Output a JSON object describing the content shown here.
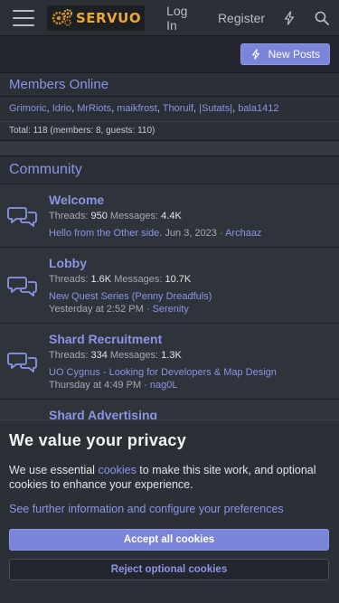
{
  "header": {
    "logo_text": "SERVUO",
    "login": "Log In",
    "register": "Register"
  },
  "new_posts_label": "New Posts",
  "members_online": {
    "title": "Members Online",
    "names": [
      "Grimoric",
      "Idrio",
      "MrRiots",
      "maikfrost",
      "Thorulf",
      "|Sutats|",
      "bala1412"
    ],
    "total": "Total: 118 (members: 8, guests: 110)"
  },
  "community": {
    "title": "Community",
    "forums": [
      {
        "title": "Welcome",
        "threads_label": "Threads:",
        "threads": "950",
        "messages_label": "Messages:",
        "messages": "4.4K",
        "latest": "Hello from the Other side.",
        "date": "Jun 3, 2023",
        "user": "Archaaz"
      },
      {
        "title": "Lobby",
        "threads_label": "Threads:",
        "threads": "1.6K",
        "messages_label": "Messages:",
        "messages": "10.7K",
        "latest": "New Quest Series (Penny Dreadfuls)",
        "date": "Yesterday at 2:52 PM",
        "user": "Serenity"
      },
      {
        "title": "Shard Recruitment",
        "threads_label": "Threads:",
        "threads": "334",
        "messages_label": "Messages:",
        "messages": "1.3K",
        "latest": "UO Cygnus - Looking for Developers & Map Design",
        "date": "Thursday at 4:49 PM",
        "user": "nag0L"
      },
      {
        "title": "Shard Advertising"
      }
    ]
  },
  "cookie": {
    "title": "We value your privacy",
    "text_before": "We use essential ",
    "text_link": "cookies",
    "text_after": " to make this site work, and optional cookies to enhance your experience.",
    "more_link": "See further information and configure your preferences",
    "accept": "Accept all cookies",
    "reject": "Reject optional cookies"
  },
  "colors": {
    "accent": "#8b95e6",
    "button": "#7a84d8",
    "background": "#23262c",
    "logo": "#e8a83a"
  }
}
